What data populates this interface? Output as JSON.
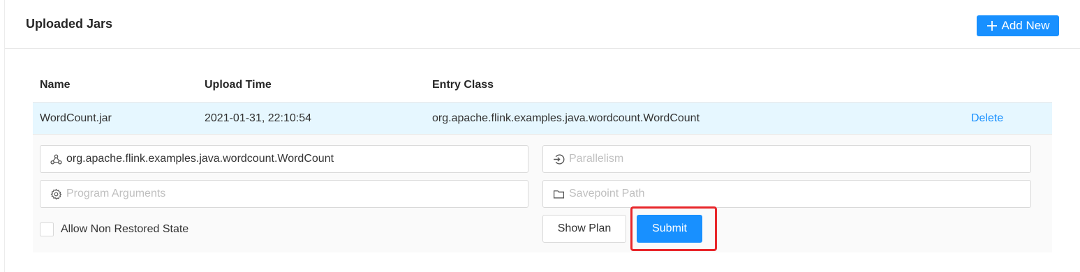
{
  "header": {
    "title": "Uploaded Jars",
    "add_button_label": "Add New"
  },
  "table": {
    "columns": [
      "Name",
      "Upload Time",
      "Entry Class"
    ],
    "rows": [
      {
        "name": "WordCount.jar",
        "upload_time": "2021-01-31, 22:10:54",
        "entry_class": "org.apache.flink.examples.java.wordcount.WordCount",
        "action_label": "Delete"
      }
    ]
  },
  "submit_form": {
    "entry_class_value": "org.apache.flink.examples.java.wordcount.WordCount",
    "parallelism_placeholder": "Parallelism",
    "program_arguments_placeholder": "Program Arguments",
    "savepoint_path_placeholder": "Savepoint Path",
    "allow_non_restored_label": "Allow Non Restored State",
    "allow_non_restored_checked": false,
    "show_plan_label": "Show Plan",
    "submit_label": "Submit"
  },
  "icons": {
    "entry_class": "cluster-icon",
    "parallelism": "login-icon",
    "program_arguments": "setting-icon",
    "savepoint_path": "folder-icon",
    "add": "plus-icon"
  },
  "colors": {
    "primary": "#1890ff",
    "selected_row": "#e6f7ff",
    "highlight": "#e8262a"
  }
}
